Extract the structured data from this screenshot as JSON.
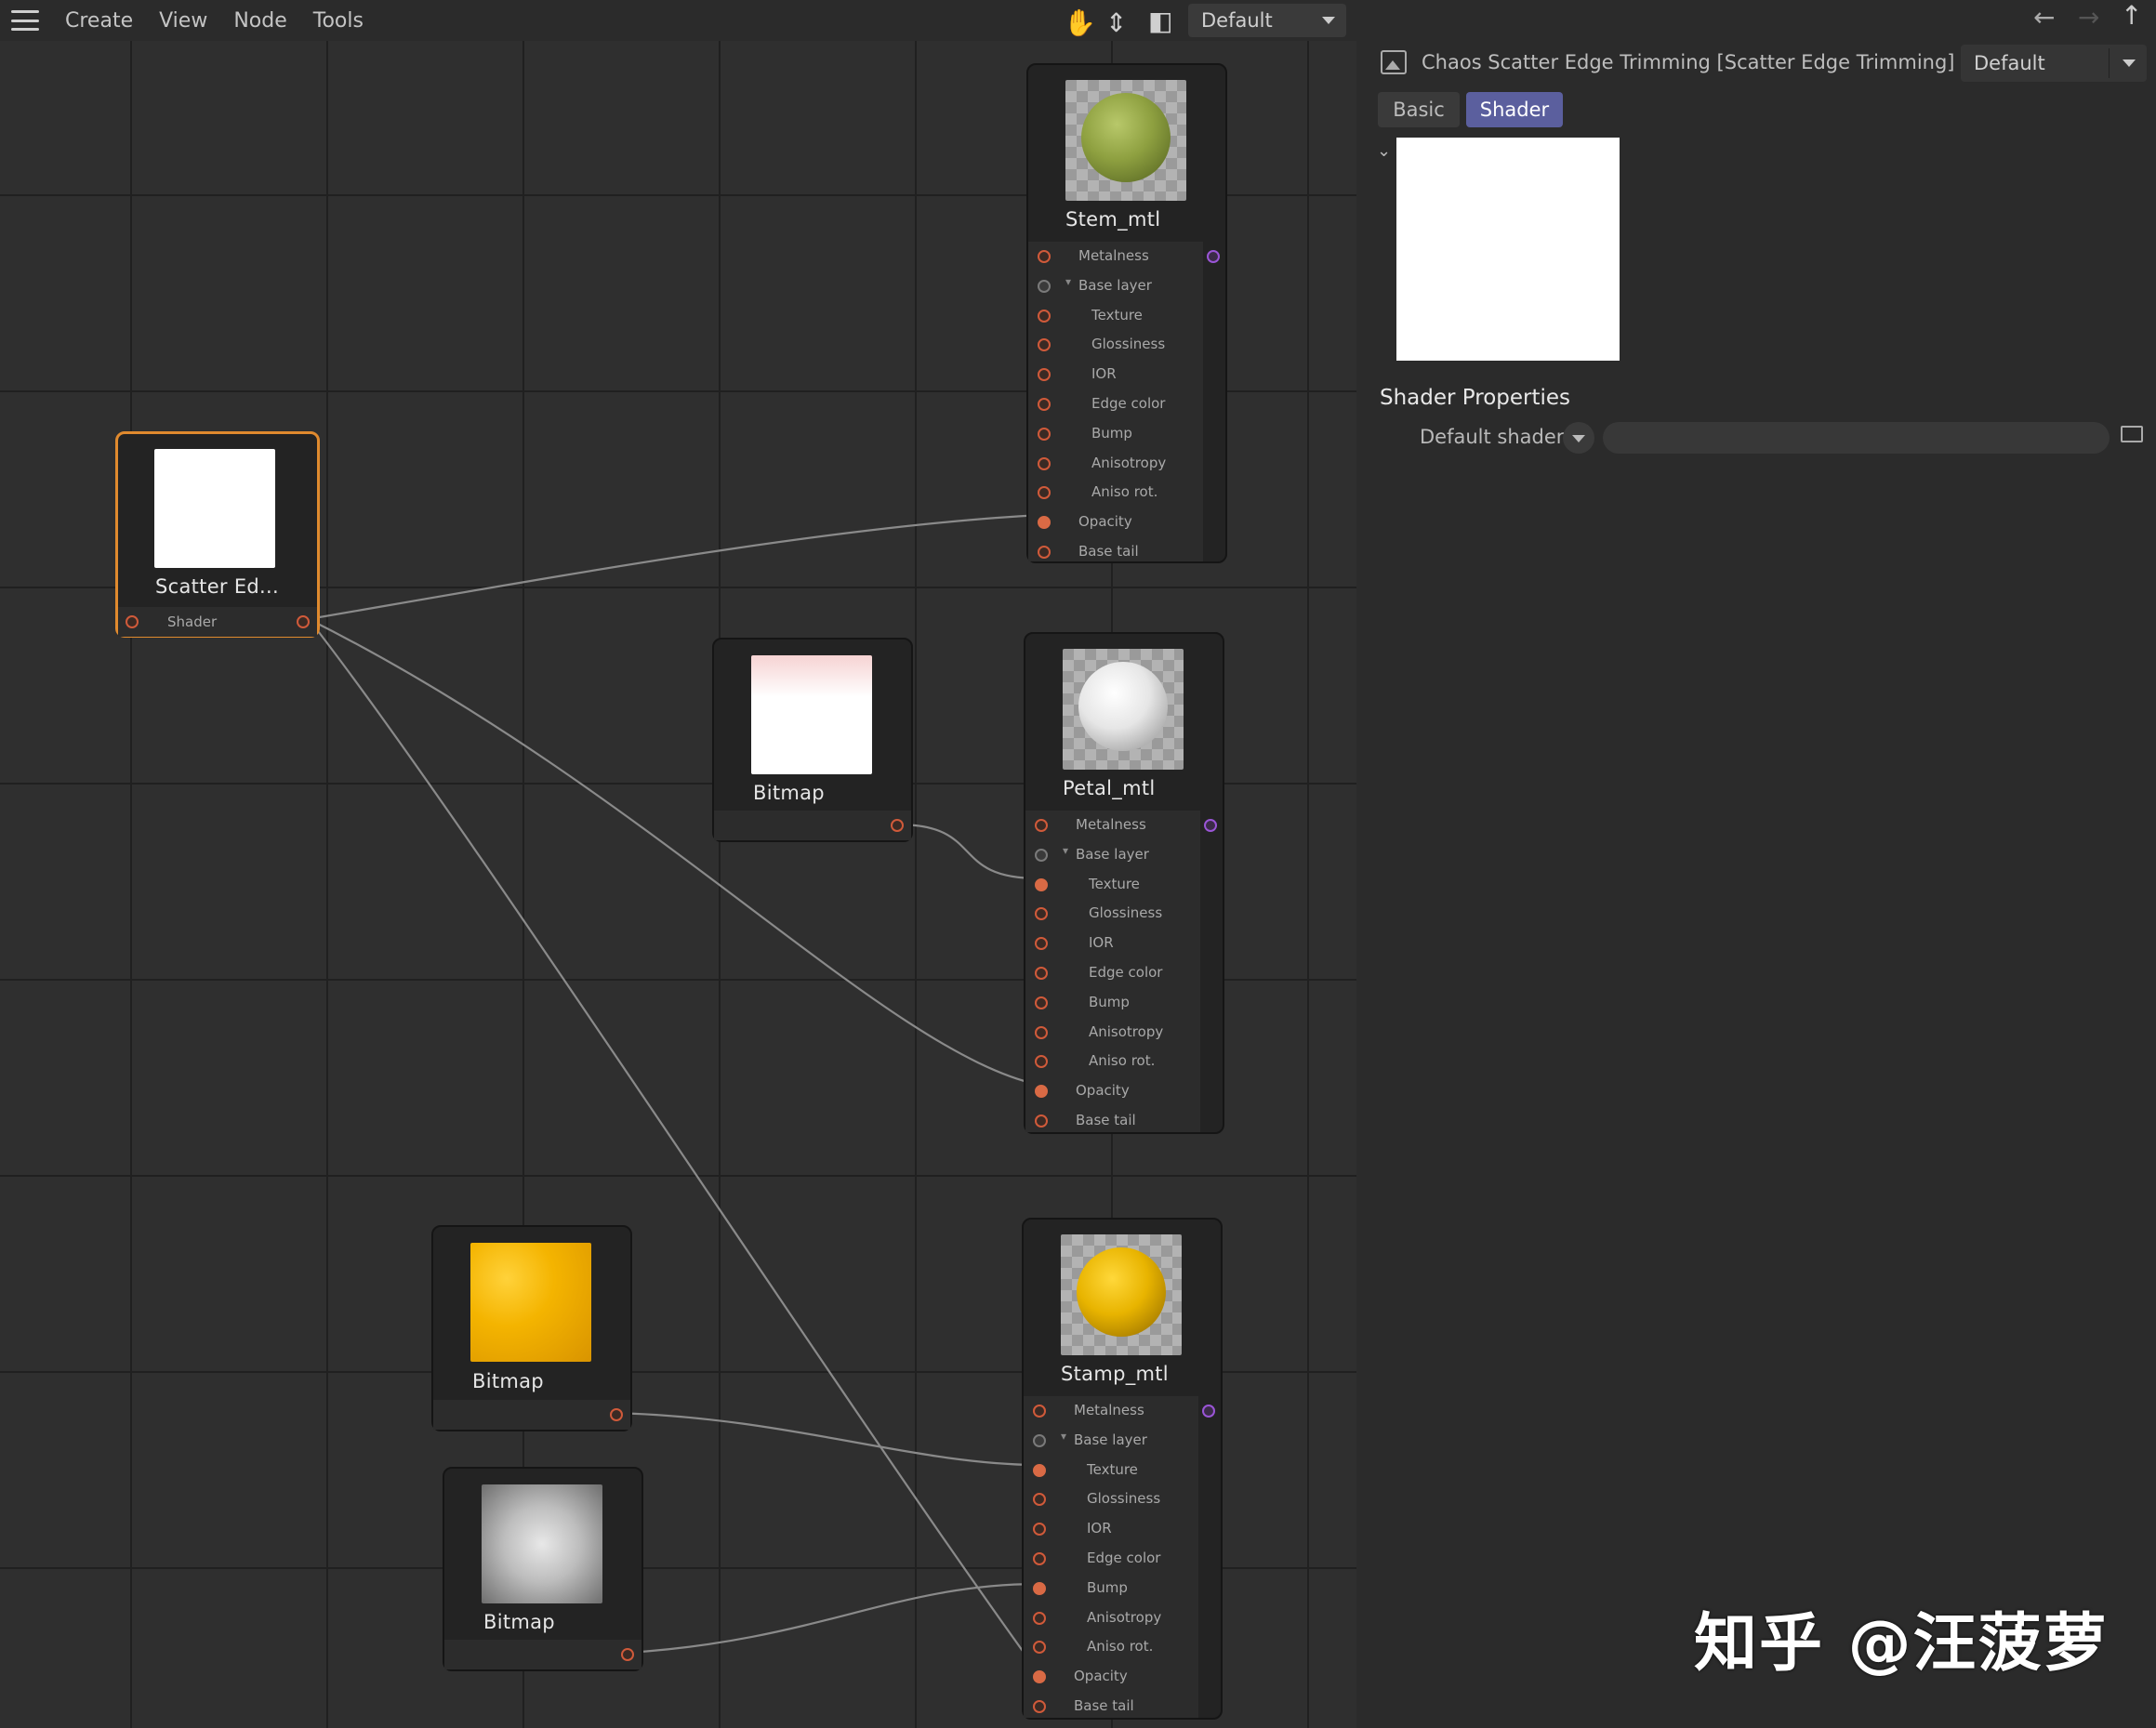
{
  "menu": {
    "items": [
      "Create",
      "View",
      "Node",
      "Tools"
    ]
  },
  "toolbar": {
    "hand_icon": "hand-icon",
    "pin_icon": "pin-icon",
    "layout_icon": "layout-icon",
    "dropdown_value": "Default"
  },
  "nav": {
    "back_icon": "arrow-left-icon",
    "forward_icon": "arrow-right-icon",
    "up_icon": "arrow-up-icon"
  },
  "nodes": {
    "scatter": {
      "title": "Scatter Ed...",
      "port": "Shader"
    },
    "bitmap1": {
      "title": "Bitmap"
    },
    "bitmap2": {
      "title": "Bitmap"
    },
    "bitmap3": {
      "title": "Bitmap"
    },
    "stem": {
      "title": "Stem_mtl"
    },
    "petal": {
      "title": "Petal_mtl"
    },
    "stamp": {
      "title": "Stamp_mtl"
    }
  },
  "material_ports": [
    "Metalness",
    "Base layer",
    "Texture",
    "Glossiness",
    "IOR",
    "Edge color",
    "Bump",
    "Anisotropy",
    "Aniso rot.",
    "Opacity",
    "Base tail"
  ],
  "panel": {
    "title": "Chaos Scatter Edge Trimming [Scatter Edge Trimming]",
    "dropdown_value": "Default",
    "tabs": {
      "basic": "Basic",
      "shader": "Shader"
    },
    "section_title": "Shader Properties",
    "default_shader_label": "Default shader",
    "default_shader_value": ""
  },
  "watermark": "知乎 @汪菠萝",
  "colors": {
    "accent_tab": "#5b5f9e",
    "selection": "#e08a2e",
    "port": "#d05a3a",
    "port_purple": "#9a55d6"
  }
}
